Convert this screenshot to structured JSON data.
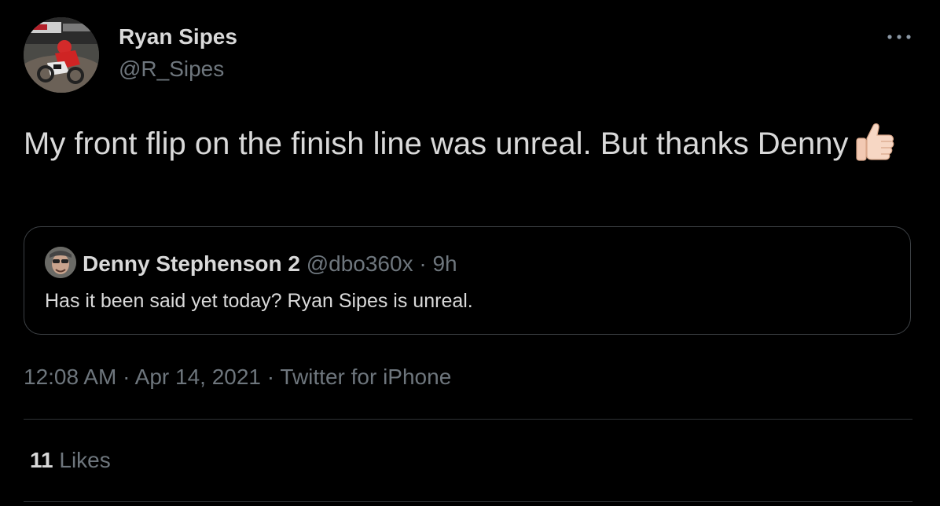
{
  "author": {
    "display_name": "Ryan Sipes",
    "handle": "@R_Sipes"
  },
  "tweet": {
    "text": "My front flip on the finish line was unreal. But thanks Denny",
    "emoji": "thumbs-up-icon"
  },
  "quoted": {
    "display_name": "Denny Stephenson 2",
    "handle": "@dbo360x",
    "separator": "·",
    "age": "9h",
    "text": "Has it been said yet today? Ryan Sipes is unreal."
  },
  "meta": {
    "time": "12:08 AM",
    "date": "Apr 14, 2021",
    "source": "Twitter for iPhone",
    "separator": "·"
  },
  "stats": {
    "likes_count": "11",
    "likes_label": "Likes"
  },
  "colors": {
    "background": "#000000",
    "text": "#d9d9d9",
    "secondary": "#6e767d",
    "border": "#2f3336"
  }
}
